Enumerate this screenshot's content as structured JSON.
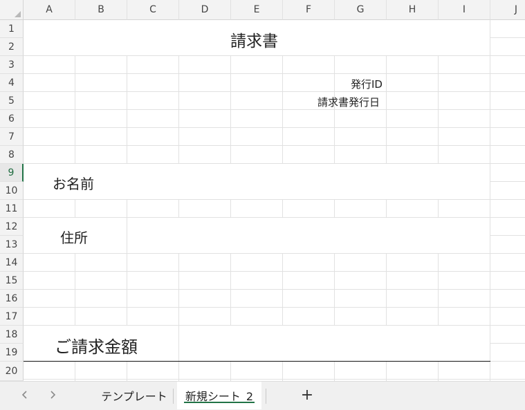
{
  "columns": [
    "A",
    "B",
    "C",
    "D",
    "E",
    "F",
    "G",
    "H",
    "I",
    "J"
  ],
  "rows": [
    "1",
    "2",
    "3",
    "4",
    "5",
    "6",
    "7",
    "8",
    "9",
    "10",
    "11",
    "12",
    "13",
    "14",
    "15",
    "16",
    "17",
    "18",
    "19",
    "20"
  ],
  "active_row": "9",
  "cells": {
    "title": "請求書",
    "issue_id_label": "発行ID",
    "issue_date_label": "請求書発行日",
    "name_label": "お名前",
    "address_label": "住所",
    "amount_label": "ご請求金額"
  },
  "tabs": {
    "prev_icon": "chevron-left-icon",
    "next_icon": "chevron-right-icon",
    "sheets": [
      "テンプレート",
      "新規シート_2"
    ],
    "active_sheet": "新規シート_2",
    "add_label": "+"
  },
  "colors": {
    "accent": "#217346",
    "grid": "#e1e1e1",
    "header_bg": "#f3f3f3"
  }
}
